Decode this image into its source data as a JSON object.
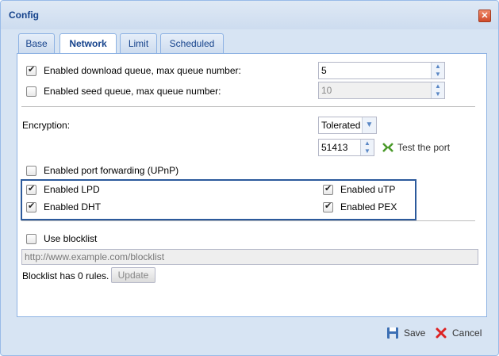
{
  "window": {
    "title": "Config"
  },
  "tabs": [
    {
      "label": "Base"
    },
    {
      "label": "Network"
    },
    {
      "label": "Limit"
    },
    {
      "label": "Scheduled"
    }
  ],
  "network": {
    "download_queue": {
      "label": "Enabled download queue, max queue number:",
      "checked": true,
      "value": "5"
    },
    "seed_queue": {
      "label": "Enabled seed queue, max queue number:",
      "checked": false,
      "value": "10"
    },
    "encryption": {
      "label": "Encryption:",
      "value": "Tolerated"
    },
    "port": {
      "value": "51413",
      "test_label": "Test the port"
    },
    "upnp": {
      "label": "Enabled port forwarding (UPnP)",
      "checked": false
    },
    "lpd": {
      "label": "Enabled LPD",
      "checked": true
    },
    "utp": {
      "label": "Enabled uTP",
      "checked": true
    },
    "dht": {
      "label": "Enabled DHT",
      "checked": true
    },
    "pex": {
      "label": "Enabled PEX",
      "checked": true
    },
    "blocklist": {
      "label": "Use blocklist",
      "checked": false,
      "url": "http://www.example.com/blocklist",
      "rules_text": "Blocklist has 0 rules.",
      "update_label": "Update"
    }
  },
  "footer": {
    "save_label": "Save",
    "cancel_label": "Cancel"
  },
  "colors": {
    "highlight_border": "#2c5a9c",
    "accent": "#15428b"
  }
}
